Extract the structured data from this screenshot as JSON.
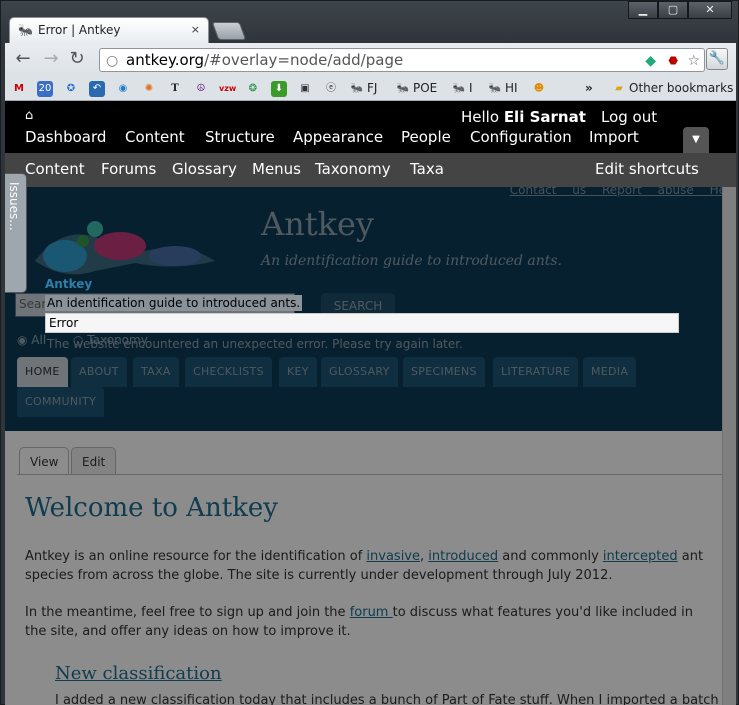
{
  "window": {
    "minimize": "▁",
    "maximize": "▢",
    "close": "✕"
  },
  "tab": {
    "title": "Error | Antkey",
    "close": "×"
  },
  "omnibox": {
    "domain": "antkey.org",
    "path": "/#overlay=node/add/page"
  },
  "bookmarks": {
    "items": [
      {
        "label": "FJ",
        "icon": "ant-icon"
      },
      {
        "label": "POE",
        "icon": "ant-icon"
      },
      {
        "label": "I",
        "icon": "ant-icon"
      },
      {
        "label": "HI",
        "icon": "ant-icon"
      }
    ],
    "more": "»",
    "other": "Other bookmarks"
  },
  "admin": {
    "home_icon": "⌂",
    "hello": "Hello",
    "user": "Eli Sarnat",
    "logout": "Log out",
    "menu": [
      "Dashboard",
      "Content",
      "Structure",
      "Appearance",
      "People",
      "Configuration",
      "Import"
    ],
    "toggle": "▼"
  },
  "shortcuts": {
    "items": [
      "Content",
      "Forums",
      "Glossary",
      "Menus",
      "Taxonomy",
      "Taxa"
    ],
    "edit": "Edit shortcuts"
  },
  "issues_tab": "Issues...",
  "site": {
    "name": "Antkey",
    "slogan": "An identification guide to introduced ants.",
    "top_links": "Contact us   Report abuse   He",
    "search_placeholder": "Search",
    "search_button": "SEARCH",
    "radio_all": "All",
    "radio_taxonomy": "Taxonomy",
    "error_message": "The website encountered an unexpected error. Please try again later.",
    "nav": [
      "HOME",
      "ABOUT",
      "TAXA",
      "CHECKLISTS",
      "KEY",
      "GLOSSARY",
      "SPECIMENS",
      "LITERATURE",
      "MEDIA",
      "COMMUNITY"
    ]
  },
  "overlay": {
    "title": "Antkey",
    "slogan": "An identification guide to introduced ants.",
    "error": "Error"
  },
  "content": {
    "tabs": [
      "View",
      "Edit"
    ],
    "heading": "Welcome to Antkey",
    "p1_a": "Antkey is an online resource for the identification of ",
    "p1_link1": "invasive",
    "p1_sep": ", ",
    "p1_link2": "introduced",
    "p1_b": " and commonly ",
    "p1_link3": "intercepted",
    "p1_c": " ant species from across the globe. The site is currently under development through July 2012.",
    "p2_a": "In the meantime, feel free to sign up and join the ",
    "p2_link": "forum ",
    "p2_b": "to discuss what features you'd like included in the site, and offer any ideas on how to improve it.",
    "h2": "New classification",
    "last": "I added a new classification today that includes a bunch of Part of Fate stuff. When I imported a batch"
  }
}
